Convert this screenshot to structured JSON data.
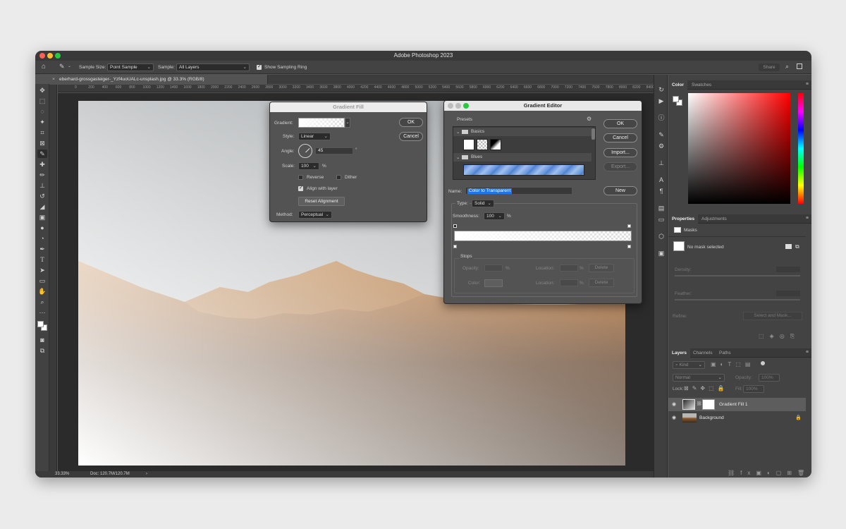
{
  "app": {
    "title": "Adobe Photoshop 2023"
  },
  "options_bar": {
    "sample_size_label": "Sample Size:",
    "sample_size_value": "Point Sample",
    "sample_label": "Sample:",
    "sample_value": "All Layers",
    "sampling_ring_label": "Show Sampling Ring",
    "share_label": "Share"
  },
  "document": {
    "tab_title": "eberhard-grossgasteiger-_Yzf4uoUALc-unsplash.jpg @ 33.3% (RGB/8)",
    "ruler_ticks": [
      "0",
      "200",
      "400",
      "600",
      "800",
      "1000",
      "1200",
      "1400",
      "1600",
      "1800",
      "2000",
      "2200",
      "2400",
      "2600",
      "2800",
      "3000",
      "3200",
      "3400",
      "3600",
      "3800",
      "4000",
      "4200",
      "4400",
      "4600",
      "4800",
      "5000",
      "5200",
      "5400",
      "5600",
      "5800",
      "6000",
      "6200",
      "6400",
      "6600",
      "6800",
      "7000",
      "7200",
      "7400",
      "7600",
      "7800",
      "8000",
      "8200",
      "8400",
      "8600"
    ],
    "zoom": "33.33%",
    "doc_info": "Doc: 120.7M/120.7M"
  },
  "gradient_fill": {
    "title": "Gradient Fill",
    "gradient_label": "Gradient:",
    "style_label": "Style:",
    "style_value": "Linear",
    "angle_label": "Angle:",
    "angle_value": "45",
    "angle_unit": "°",
    "scale_label": "Scale:",
    "scale_value": "100",
    "scale_unit": "%",
    "reverse_label": "Reverse",
    "dither_label": "Dither",
    "align_label": "Align with layer",
    "reset_label": "Reset Alignment",
    "method_label": "Method:",
    "method_value": "Perceptual",
    "ok_label": "OK",
    "cancel_label": "Cancel"
  },
  "gradient_editor": {
    "title": "Gradient Editor",
    "presets_label": "Presets",
    "group_basics": "Basics",
    "group_blues": "Blues",
    "ok_label": "OK",
    "cancel_label": "Cancel",
    "import_label": "Import...",
    "export_label": "Export...",
    "name_label": "Name:",
    "name_value": "Color to Transparent",
    "new_label": "New",
    "type_label": "Type:",
    "type_value": "Solid",
    "smoothness_label": "Smoothness:",
    "smoothness_value": "100",
    "smoothness_unit": "%",
    "stops_label": "Stops",
    "opacity_label": "Opacity:",
    "opacity_unit": "%",
    "location_label": "Location:",
    "location_unit": "%",
    "color_label": "Color:",
    "delete_label": "Delete"
  },
  "color_panel": {
    "tab_color": "Color",
    "tab_swatches": "Swatches"
  },
  "properties_panel": {
    "tab_properties": "Properties",
    "tab_adjustments": "Adjustments",
    "masks_label": "Masks",
    "no_mask": "No mask selected",
    "density_label": "Density:",
    "feather_label": "Feather:",
    "refine_label": "Refine:",
    "select_mask_label": "Select and Mask..."
  },
  "layers_panel": {
    "tab_layers": "Layers",
    "tab_channels": "Channels",
    "tab_paths": "Paths",
    "kind_label": "Kind",
    "blend_mode": "Normal",
    "opacity_label": "Opacity:",
    "opacity_value": "100%",
    "lock_label": "Lock:",
    "fill_label": "Fill:",
    "fill_value": "100%",
    "layers": [
      {
        "name": "Gradient Fill 1"
      },
      {
        "name": "Background"
      }
    ]
  },
  "colors": {
    "accent": "#1d76e6",
    "panel_bg": "#434343",
    "window_bg": "#535353"
  }
}
